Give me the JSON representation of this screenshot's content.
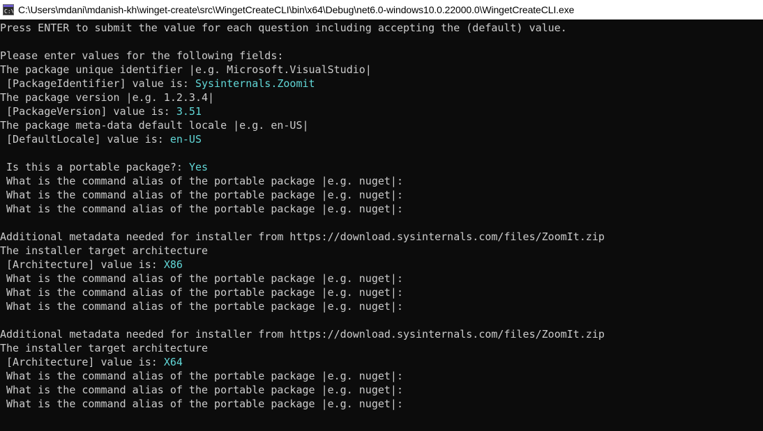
{
  "window": {
    "title": "C:\\Users\\mdani\\mdanish-kh\\winget-create\\src\\WingetCreateCLI\\bin\\x64\\Debug\\net6.0-windows10.0.22000.0\\WingetCreateCLI.exe",
    "icon": "console-app-icon",
    "colors": {
      "background": "#0c0c0c",
      "text": "#cccccc",
      "value": "#61d6d6",
      "titlebar": "#ffffff"
    }
  },
  "console": {
    "intro": "Press ENTER to submit the value for each question including accepting the (default) value.",
    "fields_header": "Please enter values for the following fields:",
    "package_id": {
      "question": "The package unique identifier |e.g. Microsoft.VisualStudio|",
      "prompt": " [PackageIdentifier] value is: ",
      "value": "Sysinternals.Zoomit"
    },
    "package_version": {
      "question": "The package version |e.g. 1.2.3.4|",
      "prompt": " [PackageVersion] value is: ",
      "value": "3.51"
    },
    "default_locale": {
      "question": "The package meta-data default locale |e.g. en-US|",
      "prompt": " [DefaultLocale] value is: ",
      "value": "en-US"
    },
    "portable": {
      "prompt": " Is this a portable package?: ",
      "value": "Yes"
    },
    "alias_prompt": " What is the command alias of the portable package |e.g. nuget|:",
    "installers": [
      {
        "header": "Additional metadata needed for installer from https://download.sysinternals.com/files/ZoomIt.zip",
        "question": "The installer target architecture",
        "prompt": " [Architecture] value is: ",
        "value": "X86"
      },
      {
        "header": "Additional metadata needed for installer from https://download.sysinternals.com/files/ZoomIt.zip",
        "question": "The installer target architecture",
        "prompt": " [Architecture] value is: ",
        "value": "X64"
      }
    ]
  }
}
